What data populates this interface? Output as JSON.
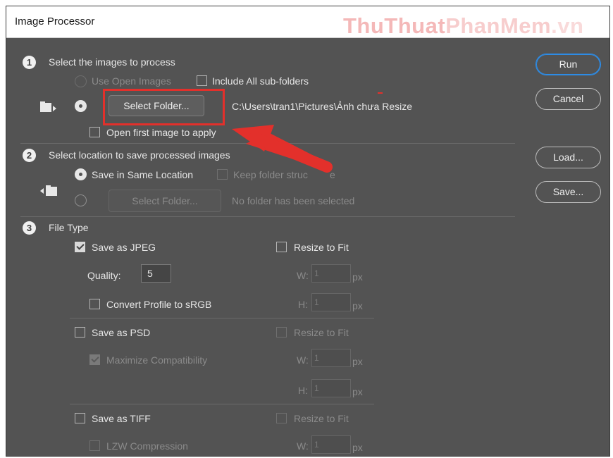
{
  "window": {
    "title": "Image Processor",
    "watermark": {
      "part1": "ThuThuat",
      "part2": "PhanMem",
      "part3": ".vn"
    }
  },
  "section1": {
    "number": "1",
    "title": "Select the images to process",
    "use_open_images": "Use Open Images",
    "include_subfolders": "Include All sub-folders",
    "select_folder": "Select Folder...",
    "folder_path": "C:\\Users\\tran1\\Pictures\\Ảnh chưa Resize",
    "open_first_image": "Open first image to apply settings",
    "open_first_image_visible": "Open first image to apply"
  },
  "section2": {
    "number": "2",
    "title": "Select location to save processed images",
    "save_same_location": "Save in Same Location",
    "keep_folder_structure": "Keep folder structure",
    "keep_folder_structure_visible": "Keep folder struc",
    "keep_folder_structure_end": "e",
    "select_folder": "Select Folder...",
    "no_folder": "No folder has been selected"
  },
  "section3": {
    "number": "3",
    "title": "File Type",
    "jpeg": {
      "label": "Save as JPEG",
      "checked": true,
      "quality_label": "Quality:",
      "quality_value": "5",
      "convert_profile": "Convert Profile to sRGB",
      "resize_to_fit": "Resize to Fit",
      "w_label": "W:",
      "w_value": "1",
      "h_label": "H:",
      "h_value": "1",
      "px": "px"
    },
    "psd": {
      "label": "Save as PSD",
      "maximize": "Maximize Compatibility",
      "resize_to_fit": "Resize to Fit",
      "w_label": "W:",
      "w_value": "1",
      "h_label": "H:",
      "h_value": "1",
      "px": "px"
    },
    "tiff": {
      "label": "Save as TIFF",
      "lzw": "LZW Compression",
      "resize_to_fit": "Resize to Fit",
      "w_label": "W:",
      "w_value": "1",
      "px": "px"
    }
  },
  "buttons": {
    "run": "Run",
    "cancel": "Cancel",
    "load": "Load...",
    "save": "Save..."
  },
  "colors": {
    "panel": "#535353",
    "accent": "#2d8ce6",
    "highlight": "#e3302b"
  }
}
